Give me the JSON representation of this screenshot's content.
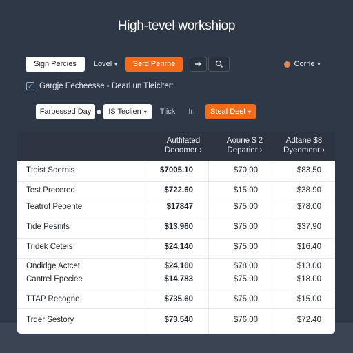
{
  "title": "High-tevel workshiop",
  "toolbar": {
    "sign_label": "Sign Percies",
    "level_label": "Lovel",
    "send_label": "Serd Perirne",
    "arrow_icon": "arrow-right-icon",
    "search_icon": "search-icon",
    "user_label": "Corrle"
  },
  "filter": {
    "checkbox_label": "Gargje Eecheesse - Dearl un Tleiclter:",
    "checked": true
  },
  "row2": {
    "period_label": "Farpessed Day",
    "section_label": "IS Teclien",
    "tick_label": "Tlick",
    "in_label": "In",
    "select_label": "Steal Deel"
  },
  "colors": {
    "accent": "#f26b1d",
    "background": "#2f3846"
  },
  "table": {
    "headers": [
      "Autfifated Deoomer ›",
      "Aourie $ 2 Deparier ›",
      "Adtane $8 Dyeomenr ›"
    ],
    "rows": [
      {
        "name": "Ttoist Soernis",
        "v1": "$7005.10",
        "v2": "$70.00",
        "v3": "$83.50"
      },
      {
        "name": "Test Precered",
        "v1": "$722.60",
        "v2": "$15.00",
        "v3": "$38.90"
      },
      {
        "name": "Teatrof Peoente",
        "v1": "$17847",
        "v2": "$75.00",
        "v3": "$78.00"
      },
      {
        "name": "Tide Pesnits",
        "v1": "$13,960",
        "v2": "$75.00",
        "v3": "$37.90"
      },
      {
        "name": "Tridek Ceteis",
        "v1": "$24,140",
        "v2": "$75.00",
        "v3": "$16.40"
      },
      {
        "name": "Ondidge Actcet",
        "v1": "$24,160",
        "v2": "$78.00",
        "v3": "$13.00"
      },
      {
        "name": "Cantrel Epeciee",
        "v1": "$14,783",
        "v2": "$75.00",
        "v3": "$18.00"
      },
      {
        "name": "TTAP Recogne",
        "v1": "$735.60",
        "v2": "$75.00",
        "v3": "$15.00"
      },
      {
        "name": "Trder Sestory",
        "v1": "$73.540",
        "v2": "$76.00",
        "v3": "$72.40"
      }
    ]
  }
}
